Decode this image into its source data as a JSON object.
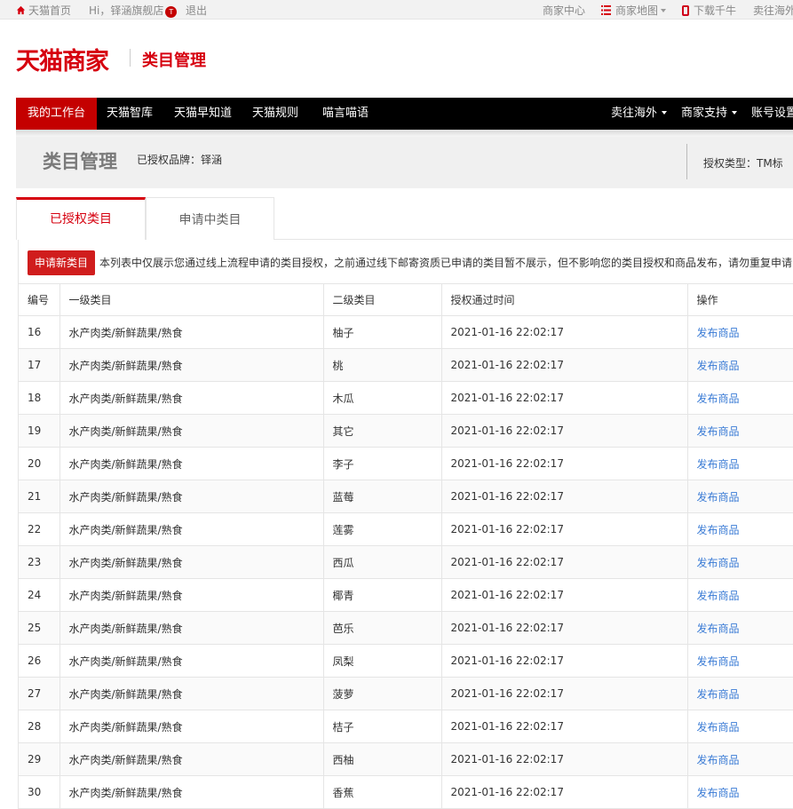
{
  "topbar": {
    "home": "天猫首页",
    "greeting": "Hi，铎涵旗舰店",
    "badge": "T",
    "logout": "退出",
    "merchant_center": "商家中心",
    "merchant_map": "商家地图",
    "download": "下载千牛",
    "sell_overseas": "卖往海外"
  },
  "header": {
    "logo": "天猫商家",
    "subtitle": "类目管理"
  },
  "nav": {
    "items": [
      "我的工作台",
      "天猫智库",
      "天猫早知道",
      "天猫规则",
      "喵言喵语"
    ],
    "right": [
      "卖往海外",
      "商家支持",
      "账号设置"
    ]
  },
  "page": {
    "title": "类目管理",
    "brand": "已授权品牌：铎涵",
    "auth_type": "授权类型：TM标"
  },
  "tabs": [
    "已授权类目",
    "申请中类目"
  ],
  "notice": {
    "button": "申请新类目",
    "text": "本列表中仅展示您通过线上流程申请的类目授权，之前通过线下邮寄资质已申请的类目暂不展示，但不影响您的类目授权和商品发布，请勿重复申请"
  },
  "table": {
    "headers": [
      "编号",
      "一级类目",
      "二级类目",
      "授权通过时间",
      "操作"
    ],
    "rows": [
      [
        "16",
        "水产肉类/新鲜蔬果/熟食",
        "柚子",
        "2021-01-16 22:02:17",
        "发布商品"
      ],
      [
        "17",
        "水产肉类/新鲜蔬果/熟食",
        "桃",
        "2021-01-16 22:02:17",
        "发布商品"
      ],
      [
        "18",
        "水产肉类/新鲜蔬果/熟食",
        "木瓜",
        "2021-01-16 22:02:17",
        "发布商品"
      ],
      [
        "19",
        "水产肉类/新鲜蔬果/熟食",
        "其它",
        "2021-01-16 22:02:17",
        "发布商品"
      ],
      [
        "20",
        "水产肉类/新鲜蔬果/熟食",
        "李子",
        "2021-01-16 22:02:17",
        "发布商品"
      ],
      [
        "21",
        "水产肉类/新鲜蔬果/熟食",
        "蓝莓",
        "2021-01-16 22:02:17",
        "发布商品"
      ],
      [
        "22",
        "水产肉类/新鲜蔬果/熟食",
        "莲雾",
        "2021-01-16 22:02:17",
        "发布商品"
      ],
      [
        "23",
        "水产肉类/新鲜蔬果/熟食",
        "西瓜",
        "2021-01-16 22:02:17",
        "发布商品"
      ],
      [
        "24",
        "水产肉类/新鲜蔬果/熟食",
        "椰青",
        "2021-01-16 22:02:17",
        "发布商品"
      ],
      [
        "25",
        "水产肉类/新鲜蔬果/熟食",
        "芭乐",
        "2021-01-16 22:02:17",
        "发布商品"
      ],
      [
        "26",
        "水产肉类/新鲜蔬果/熟食",
        "凤梨",
        "2021-01-16 22:02:17",
        "发布商品"
      ],
      [
        "27",
        "水产肉类/新鲜蔬果/熟食",
        "菠萝",
        "2021-01-16 22:02:17",
        "发布商品"
      ],
      [
        "28",
        "水产肉类/新鲜蔬果/熟食",
        "桔子",
        "2021-01-16 22:02:17",
        "发布商品"
      ],
      [
        "29",
        "水产肉类/新鲜蔬果/熟食",
        "西柚",
        "2021-01-16 22:02:17",
        "发布商品"
      ],
      [
        "30",
        "水产肉类/新鲜蔬果/熟食",
        "香蕉",
        "2021-01-16 22:02:17",
        "发布商品"
      ]
    ]
  },
  "colors": {
    "brand_red": "#d6000f",
    "link_blue": "#3a7bd5",
    "nav_black": "#000000"
  }
}
